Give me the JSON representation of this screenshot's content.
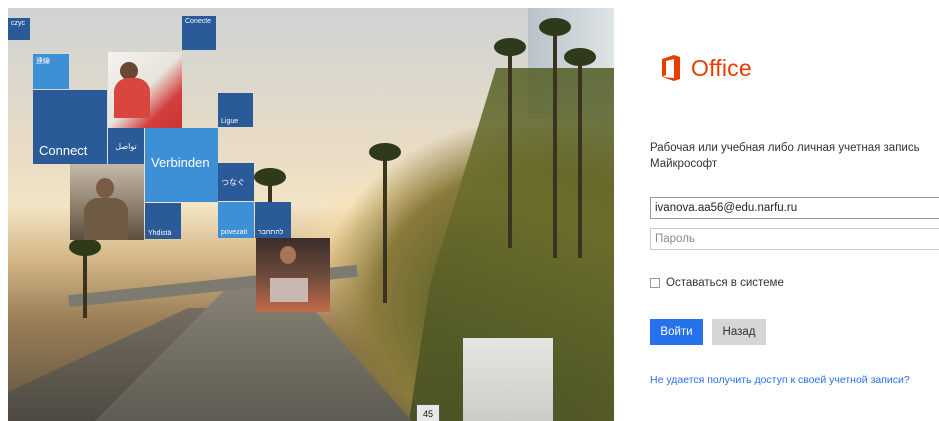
{
  "brand": {
    "logo_text": "Office",
    "logo_color": "#eb3c00"
  },
  "hero": {
    "tiles": {
      "t1": "czyc",
      "t2": "Conecte",
      "t3": "連線",
      "t4": "Ligue",
      "t5": "Connect",
      "t6": "تواصل",
      "t7": "Verbinden",
      "t8": "つなぐ",
      "t9": "Yhdistä",
      "t10": "povezati",
      "t11": "להתחבר"
    },
    "road_sign": "45"
  },
  "signin": {
    "heading": "Рабочая или учебная либо личная учетная запись Майкрософт",
    "email_value": "ivanova.aa56@edu.narfu.ru",
    "password_placeholder": "Пароль",
    "remember_label": "Оставаться в системе",
    "signin_button": "Войти",
    "back_button": "Назад",
    "help_link": "Не удается получить доступ к своей учетной записи?"
  },
  "colors": {
    "accent": "#2672ec",
    "tile_dark": "#2a5a97",
    "tile_light": "#3d8fd6"
  }
}
